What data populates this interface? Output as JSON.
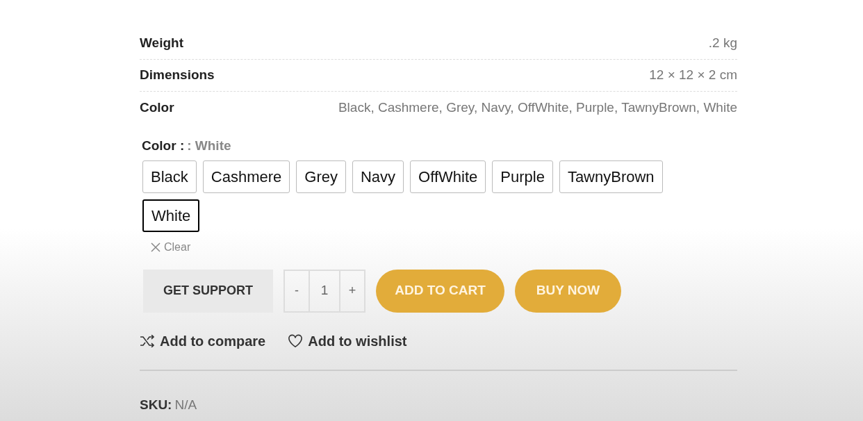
{
  "attributes": [
    {
      "label": "Weight",
      "value": ".2 kg"
    },
    {
      "label": "Dimensions",
      "value": "12 × 12 × 2 cm"
    },
    {
      "label": "Color",
      "value": "Black, Cashmere, Grey, Navy, OffWhite, Purple, TawnyBrown, White"
    }
  ],
  "variation": {
    "label": "Color :",
    "chosen": ": White",
    "options": [
      {
        "label": "Black",
        "selected": false
      },
      {
        "label": "Cashmere",
        "selected": false
      },
      {
        "label": "Grey",
        "selected": false
      },
      {
        "label": "Navy",
        "selected": false
      },
      {
        "label": "OffWhite",
        "selected": false
      },
      {
        "label": "Purple",
        "selected": false
      },
      {
        "label": "TawnyBrown",
        "selected": false
      },
      {
        "label": "White",
        "selected": true
      }
    ],
    "clear": "Clear"
  },
  "actions": {
    "support": "GET SUPPORT",
    "minus": "-",
    "quantity": "1",
    "plus": "+",
    "add_to_cart": "ADD TO CART",
    "buy_now": "BUY NOW"
  },
  "links": {
    "compare": "Add to compare",
    "wishlist": "Add to wishlist"
  },
  "sku": {
    "label": "SKU:",
    "value": "N/A"
  }
}
